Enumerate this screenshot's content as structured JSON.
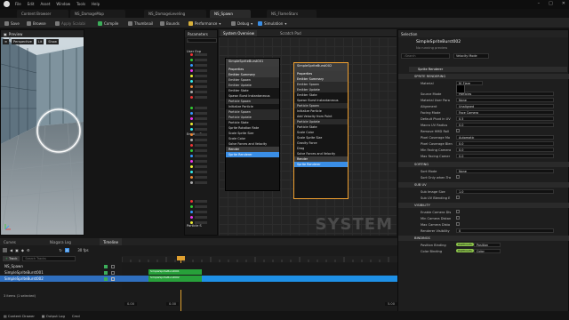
{
  "menubar": {
    "menus": [
      "File",
      "Edit",
      "Asset",
      "Window",
      "Tools",
      "Help"
    ]
  },
  "tabs": [
    {
      "label": "Content Browser",
      "active": false
    },
    {
      "label": "NS_DamageMap",
      "active": false
    },
    {
      "label": "NS_DamageLeveling",
      "active": false
    },
    {
      "label": "NS_Spawn",
      "active": true
    },
    {
      "label": "NS_FlameStars",
      "active": false
    }
  ],
  "toolbar": {
    "items": [
      "Save",
      "Browse",
      "Apply Scalabi",
      "Compile",
      "Thumbnail",
      "Bounds",
      "Performance",
      "Debug",
      "Simulation"
    ]
  },
  "preview": {
    "title": "Preview",
    "perspective": "Perspective",
    "lit": "Lit",
    "show": "Show"
  },
  "parameters": {
    "title": "Parameters",
    "user_exposed": "User Exp",
    "emitter_spawn": "Emitter S",
    "particle_spawn": "Particle S"
  },
  "system_overview": {
    "title": "System Overview",
    "scratch_pad": "Scratch Pad",
    "system_label": "NS_Spawn"
  },
  "graph": {
    "watermark": "SYSTEM",
    "node1": {
      "title": "SimpleSpriteBurst001",
      "sections": [
        "Properties",
        "Emitter Summary",
        "Emitter Spawn",
        "Emitter Update",
        "Emitter State",
        "Spawn Burst Instantaneous",
        "Particle Spawn",
        "Initialize Particle",
        "Particle Spawn",
        "Particle Update",
        "Particle State",
        "Sprite Rotation Rate",
        "Scale Sprite Size",
        "Scale Color",
        "Solve Forces and Velocity",
        "Render",
        "Sprite Renderer"
      ],
      "stage_label": "Stage"
    },
    "node2": {
      "title": "SimpleSpriteBurst002",
      "sections": [
        "Properties",
        "Emitter Summary",
        "Emitter Spawn",
        "Emitter Update",
        "Emitter State",
        "Spawn Burst Instantaneous",
        "Particle Spawn",
        "Initialize Particle",
        "Add Velocity from Point",
        "Particle Update",
        "Particle State",
        "Scale Color",
        "Scale Sprite Size",
        "Gravity Force",
        "Drag",
        "Solve Forces and Velocity",
        "Render",
        "Sprite Renderer"
      ],
      "stage_label": "Stage"
    }
  },
  "details": {
    "tab": "Selection",
    "title": "SimpleSpriteBurst002",
    "subtitle": "No running preview",
    "search_placeholder": "Search",
    "dropdown": "Velocity Mode",
    "module": "Sprite Renderer",
    "section_sprite": "SPRITE RENDERING",
    "rows": [
      {
        "label": "Material",
        "value": "M_Flare"
      },
      {
        "label": "Source Mode",
        "value": "Particles"
      },
      {
        "label": "Material User Para",
        "value": "None"
      },
      {
        "label": "Alignment",
        "value": "Unaligned"
      },
      {
        "label": "Facing Mode",
        "value": "Face Camera"
      },
      {
        "label": "Default Pivot in UV",
        "value": "0.5"
      },
      {
        "label": "Macro UV Radius",
        "value": "0.0"
      },
      {
        "label": "Remove HMD Roll",
        "value": ""
      },
      {
        "label": "Pixel Coverage Mo",
        "value": "Automatic"
      },
      {
        "label": "Pixel Coverage Blen",
        "value": "0.0"
      },
      {
        "label": "Min Facing Camera",
        "value": "0.0"
      },
      {
        "label": "Max Facing Camer",
        "value": "0.0"
      }
    ],
    "section_sorting": "SORTING",
    "sort_rows": [
      {
        "label": "Sort Mode",
        "value": "None"
      },
      {
        "label": "Sort Only when Tra",
        "value": ""
      }
    ],
    "section_subuv": "SUB UV",
    "subuv_rows": [
      {
        "label": "Sub Image Size",
        "value": "1.0"
      },
      {
        "label": "Sub UV Blending E",
        "value": ""
      }
    ],
    "section_visibility": "VISIBILITY",
    "vis_rows": [
      {
        "label": "Enable Camera Dis",
        "value": ""
      },
      {
        "label": "Min Camera Distan",
        "value": ""
      },
      {
        "label": "Max Camera Dista",
        "value": ""
      },
      {
        "label": "Renderer Visibility",
        "value": "0"
      }
    ],
    "section_bindings": "BINDINGS",
    "binding_rows": [
      {
        "label": "Position Binding",
        "value": "PARTICLES",
        "extra": "Position"
      },
      {
        "label": "Color Binding",
        "value": "PARTICLES",
        "extra": "Color"
      }
    ],
    "default_pivot_y": "0.5",
    "subimage_y": "1.0"
  },
  "timeline": {
    "tabs": [
      "Curves",
      "Niagara Log",
      "Timeline"
    ],
    "fps": "30 fps",
    "track_btn": "Track",
    "filter_placeholder": "Search Tracks",
    "tracks": [
      "NS_Spawn",
      "SimpleSpriteBurst001",
      "SimpleSpriteBurst002"
    ],
    "clip_labels": [
      "SimpleSpriteBurst001",
      "SimpleSpriteBurst002"
    ],
    "start": "0.00",
    "end": "5.00",
    "current": "0.00",
    "status": "3 items (1 selected)"
  },
  "statusbar": {
    "items": [
      "Content Drawer",
      "Output Log",
      "Cmd"
    ]
  },
  "colors": {
    "accent": "#3a8ee6",
    "green": "#3cae5a",
    "emitter": "#3a3a3a"
  }
}
